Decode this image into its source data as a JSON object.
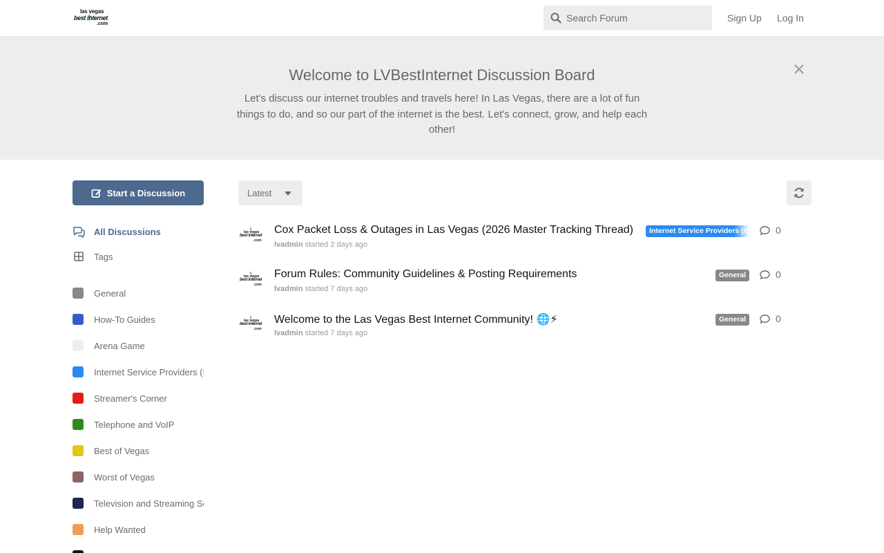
{
  "header": {
    "logo": {
      "line1": "las vegas",
      "line2": "best internet",
      "line3": ".com"
    },
    "search": {
      "placeholder": "Search Forum",
      "value": ""
    },
    "signup_label": "Sign Up",
    "login_label": "Log In"
  },
  "hero": {
    "title": "Welcome to LVBestInternet Discussion Board",
    "text": "Let's discuss our internet troubles and travels here! In Las Vegas, there are a lot of fun things to do, and so our part of the internet is the best. Let's connect, grow, and help each other!"
  },
  "sidebar": {
    "start_label": "Start a Discussion",
    "nav": [
      {
        "label": "All Discussions",
        "icon": "discussions-icon",
        "active": true
      },
      {
        "label": "Tags",
        "icon": "tags-grid-icon",
        "active": false
      }
    ],
    "tags": [
      {
        "label": "General",
        "color": "#888888"
      },
      {
        "label": "How-To Guides",
        "color": "#3a5bc7"
      },
      {
        "label": "Arena Game",
        "color": "#eeeeee"
      },
      {
        "label": "Internet Service Providers (ISPs)",
        "color": "#2b8af2"
      },
      {
        "label": "Streamer's Corner",
        "color": "#e51b1b"
      },
      {
        "label": "Telephone and VoIP",
        "color": "#2e8a1a"
      },
      {
        "label": "Best of Vegas",
        "color": "#e0c814"
      },
      {
        "label": "Worst of Vegas",
        "color": "#8c6464"
      },
      {
        "label": "Television and Streaming Services",
        "color": "#1f2450"
      },
      {
        "label": "Help Wanted",
        "color": "#f29a52"
      },
      {
        "label": "",
        "color": "#111111"
      }
    ]
  },
  "toolbar": {
    "sort_label": "Latest",
    "refresh_icon": "refresh-icon"
  },
  "discussions": [
    {
      "title": "Cox Packet Loss & Outages in Las Vegas (2026 Master Tracking Thread)",
      "user": "lvadmin",
      "started": "started 2 days ago",
      "tag": "Internet Service Providers (ISPs)",
      "tag_color": "#2b8af2",
      "replies": "0"
    },
    {
      "title": "Forum Rules: Community Guidelines & Posting Requirements",
      "user": "lvadmin",
      "started": "started 7 days ago",
      "tag": "General",
      "tag_color": "#888888",
      "replies": "0"
    },
    {
      "title": "Welcome to the Las Vegas Best Internet Community! 🌐⚡",
      "user": "lvadmin",
      "started": "started 7 days ago",
      "tag": "General",
      "tag_color": "#888888",
      "replies": "0"
    }
  ]
}
